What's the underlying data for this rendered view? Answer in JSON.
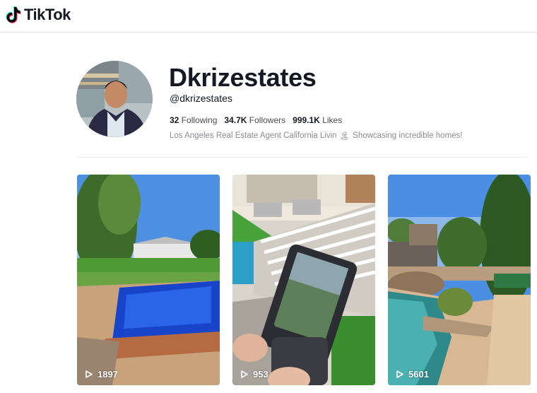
{
  "brand": {
    "name": "TikTok"
  },
  "profile": {
    "display_name": "Dkrizestates",
    "handle": "@dkrizestates",
    "stats": {
      "following_count": "32",
      "following_label": "Following",
      "followers_count": "34.7K",
      "followers_label": "Followers",
      "likes_count": "999.1K",
      "likes_label": "Likes"
    },
    "bio_before": "Los Angeles Real Estate Agent California Livin",
    "bio_emoji": "🏝",
    "bio_after": "Showcasing incredible homes!"
  },
  "videos": [
    {
      "views": "1897",
      "icon": "play-icon"
    },
    {
      "views": "953",
      "icon": "play-icon"
    },
    {
      "views": "5601",
      "icon": "play-icon"
    }
  ],
  "colors": {
    "text": "#161823",
    "muted": "#8a8b91",
    "divider": "#efeff0"
  }
}
